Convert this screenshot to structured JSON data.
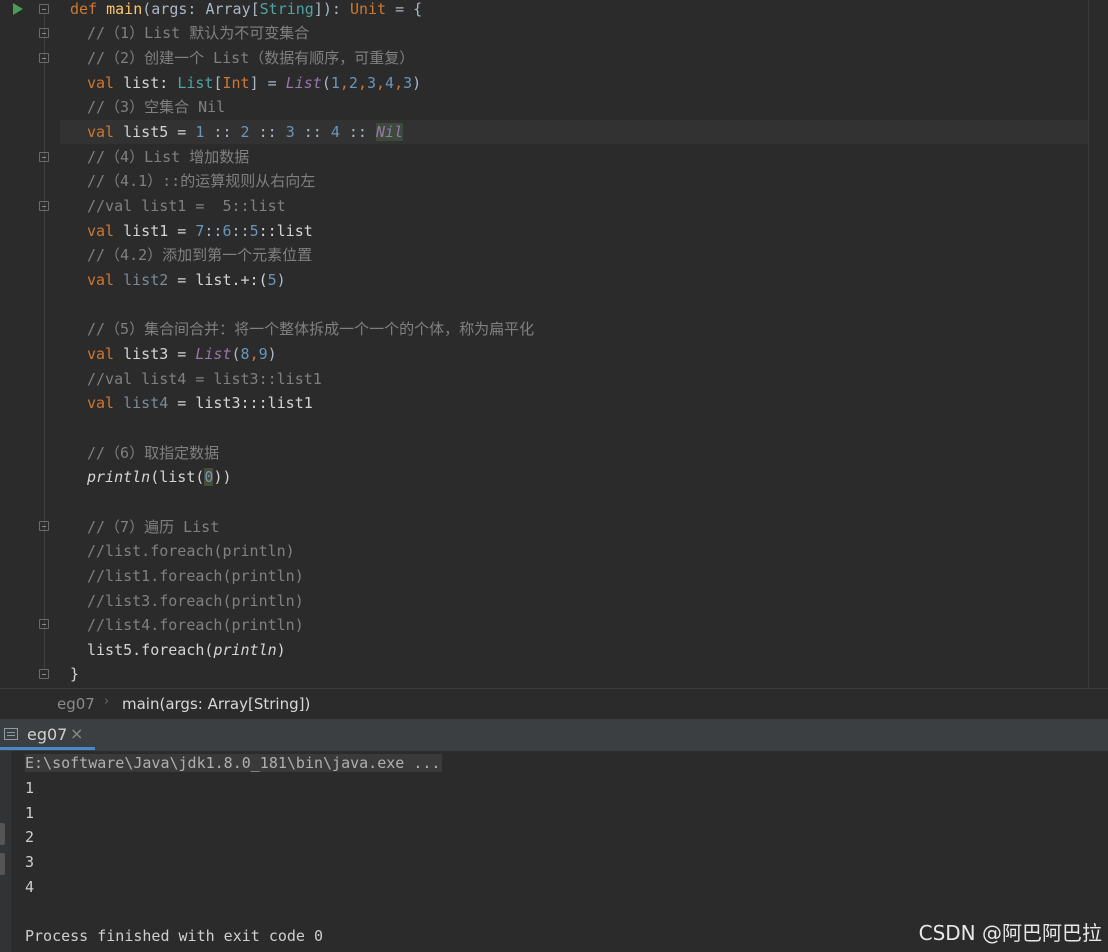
{
  "editor": {
    "lines": {
      "l0_def": "def",
      "l0_main": "main",
      "l0_args": "(args: Array[",
      "l0_string": "String",
      "l0_close": "]): ",
      "l0_unit": "Unit",
      "l0_eq": " = {",
      "l1": "//（1）List 默认为不可变集合",
      "l2": "//（2）创建一个 List（数据有顺序，可重复）",
      "l3_val": "val",
      "l3_name": " list: ",
      "l3_type": "List",
      "l3_b1": "[",
      "l3_int": "Int",
      "l3_b2": "] = ",
      "l3_ctor": "List",
      "l3_p1": "(",
      "l3_n1": "1",
      "l3_c1": ",",
      "l3_n2": "2",
      "l3_c2": ",",
      "l3_n3": "3",
      "l3_c3": ",",
      "l3_n4": "4",
      "l3_c4": ",",
      "l3_n5": "3",
      "l3_p2": ")",
      "l4": "//（3）空集合 Nil",
      "l5_val": "val",
      "l5_name": " list5 = ",
      "l5_n1": "1",
      "l5_o1": " :: ",
      "l5_n2": "2",
      "l5_o2": " :: ",
      "l5_n3": "3",
      "l5_o3": " :: ",
      "l5_n4": "4",
      "l5_o4": " :: ",
      "l5_nil": "Nil",
      "l6": "//（4）List 增加数据",
      "l7": "//（4.1）::的运算规则从右向左",
      "l8": "//val list1 =  5::list",
      "l9_val": "val",
      "l9_name": " list1 = ",
      "l9_n1": "7",
      "l9_o1": "::",
      "l9_n2": "6",
      "l9_o2": "::",
      "l9_n3": "5",
      "l9_rest": "::list",
      "l10": "//（4.2）添加到第一个元素位置",
      "l11_val": "val",
      "l11_name": " list2",
      "l11_mid": " = list.+:(",
      "l11_n": "5",
      "l11_end": ")",
      "l13": "//（5）集合间合并：将一个整体拆成一个一个的个体，称为扁平化",
      "l14_val": "val",
      "l14_name": " list3 = ",
      "l14_ctor": "List",
      "l14_p1": "(",
      "l14_n1": "8",
      "l14_c": ",",
      "l14_n2": "9",
      "l14_p2": ")",
      "l15": "//val list4 = list3::list1",
      "l16_val": "val",
      "l16_name": " list4",
      "l16_rest": " = list3:::list1",
      "l18": "//（6）取指定数据",
      "l19_fn": "println",
      "l19_a": "(list(",
      "l19_n": "0",
      "l19_b": "))",
      "l21": "//（7）遍历 List",
      "l22": "//list.foreach(println)",
      "l23": "//list1.foreach(println)",
      "l24": "//list3.foreach(println)",
      "l25": "//list4.foreach(println)",
      "l26_a": "list5.foreach(",
      "l26_fn": "println",
      "l26_b": ")",
      "l27": "}"
    }
  },
  "breadcrumb": {
    "object": "eg07",
    "separator": "›",
    "method": "main(args: Array[String])"
  },
  "run_panel": {
    "tab_label": "eg07",
    "close_glyph": "×"
  },
  "console": {
    "command": "E:\\software\\Java\\jdk1.8.0_181\\bin\\java.exe ...",
    "output": [
      "1",
      "1",
      "2",
      "3",
      "4"
    ],
    "exit_message": "Process finished with exit code 0"
  },
  "watermark": "CSDN @阿巴阿巴拉",
  "icons": {
    "run": "run-gutter-icon",
    "fold": "fold-marker-icon",
    "console_tab": "console-tab-icon"
  },
  "colors": {
    "background": "#2b2b2b",
    "keyword": "#cc7832",
    "function": "#ffc66d",
    "number": "#6897bb",
    "comment": "#808080",
    "italic_call": "#9876aa",
    "tab_accent": "#4a88c7"
  }
}
